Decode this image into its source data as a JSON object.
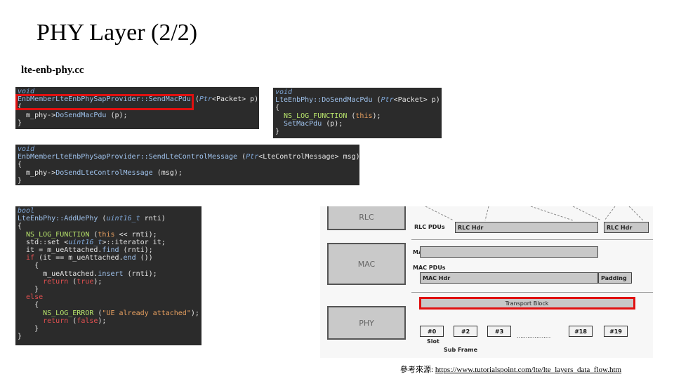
{
  "title": "PHY Layer (2/2)",
  "subtitle": "lte-enb-phy.cc",
  "code_blocks": [
    {
      "lines": [
        [
          {
            "c": "kw",
            "t": "void"
          }
        ],
        [
          {
            "c": "fn",
            "t": "EnbMemberLteEnbPhySapProvider::SendMacPdu"
          },
          {
            "c": "tx",
            "t": " ("
          },
          {
            "c": "kw",
            "t": "Ptr"
          },
          {
            "c": "tx",
            "t": "<Packet> p)"
          }
        ],
        [
          {
            "c": "tx",
            "t": "{"
          }
        ],
        [
          {
            "c": "tx",
            "t": "  m_phy->"
          },
          {
            "c": "fn",
            "t": "DoSendMacPdu"
          },
          {
            "c": "tx",
            "t": " (p);"
          }
        ],
        [
          {
            "c": "tx",
            "t": "}"
          }
        ]
      ]
    },
    {
      "lines": [
        [
          {
            "c": "kw",
            "t": "void"
          }
        ],
        [
          {
            "c": "fn",
            "t": "LteEnbPhy::DoSendMacPdu"
          },
          {
            "c": "tx",
            "t": " ("
          },
          {
            "c": "kw",
            "t": "Ptr"
          },
          {
            "c": "tx",
            "t": "<Packet> p)"
          }
        ],
        [
          {
            "c": "tx",
            "t": "{"
          }
        ],
        [
          {
            "c": "mac",
            "t": "  NS_LOG_FUNCTION"
          },
          {
            "c": "tx",
            "t": " ("
          },
          {
            "c": "str",
            "t": "this"
          },
          {
            "c": "tx",
            "t": ");"
          }
        ],
        [
          {
            "c": "fn",
            "t": "  SetMacPdu"
          },
          {
            "c": "tx",
            "t": " (p);"
          }
        ],
        [
          {
            "c": "tx",
            "t": "}"
          }
        ]
      ]
    },
    {
      "lines": [
        [
          {
            "c": "kw",
            "t": "void"
          }
        ],
        [
          {
            "c": "fn",
            "t": "EnbMemberLteEnbPhySapProvider::SendLteControlMessage"
          },
          {
            "c": "tx",
            "t": " ("
          },
          {
            "c": "kw",
            "t": "Ptr"
          },
          {
            "c": "tx",
            "t": "<LteControlMessage> msg)"
          }
        ],
        [
          {
            "c": "tx",
            "t": "{"
          }
        ],
        [
          {
            "c": "tx",
            "t": "  m_phy->"
          },
          {
            "c": "fn",
            "t": "DoSendLteControlMessage"
          },
          {
            "c": "tx",
            "t": " (msg);"
          }
        ],
        [
          {
            "c": "tx",
            "t": "}"
          }
        ]
      ]
    },
    {
      "lines": [
        [
          {
            "c": "kw",
            "t": "bool"
          }
        ],
        [
          {
            "c": "fn",
            "t": "LteEnbPhy::AddUePhy"
          },
          {
            "c": "tx",
            "t": " ("
          },
          {
            "c": "kw",
            "t": "uint16_t"
          },
          {
            "c": "tx",
            "t": " rnti)"
          }
        ],
        [
          {
            "c": "tx",
            "t": "{"
          }
        ],
        [
          {
            "c": "mac",
            "t": "  NS_LOG_FUNCTION"
          },
          {
            "c": "tx",
            "t": " ("
          },
          {
            "c": "str",
            "t": "this"
          },
          {
            "c": "tx",
            "t": " << rnti);"
          }
        ],
        [
          {
            "c": "tx",
            "t": "  std::set <"
          },
          {
            "c": "kw",
            "t": "uint16_t"
          },
          {
            "c": "tx",
            "t": ">::iterator it;"
          }
        ],
        [
          {
            "c": "tx",
            "t": "  it = m_ueAttached."
          },
          {
            "c": "fn",
            "t": "find"
          },
          {
            "c": "tx",
            "t": " (rnti);"
          }
        ],
        [
          {
            "c": "red-kw",
            "t": "  if"
          },
          {
            "c": "tx",
            "t": " (it == m_ueAttached."
          },
          {
            "c": "fn",
            "t": "end"
          },
          {
            "c": "tx",
            "t": " ())"
          }
        ],
        [
          {
            "c": "tx",
            "t": "    {"
          }
        ],
        [
          {
            "c": "tx",
            "t": "      m_ueAttached."
          },
          {
            "c": "fn",
            "t": "insert"
          },
          {
            "c": "tx",
            "t": " (rnti);"
          }
        ],
        [
          {
            "c": "red-kw",
            "t": "      return"
          },
          {
            "c": "tx",
            "t": " ("
          },
          {
            "c": "red-kw",
            "t": "true"
          },
          {
            "c": "tx",
            "t": ");"
          }
        ],
        [
          {
            "c": "tx",
            "t": "    }"
          }
        ],
        [
          {
            "c": "red-kw",
            "t": "  else"
          }
        ],
        [
          {
            "c": "tx",
            "t": "    {"
          }
        ],
        [
          {
            "c": "mac",
            "t": "      NS_LOG_ERROR"
          },
          {
            "c": "tx",
            "t": " ("
          },
          {
            "c": "str",
            "t": "\"UE already attached\""
          },
          {
            "c": "tx",
            "t": ");"
          }
        ],
        [
          {
            "c": "red-kw",
            "t": "      return"
          },
          {
            "c": "tx",
            "t": " ("
          },
          {
            "c": "red-kw",
            "t": "false"
          },
          {
            "c": "tx",
            "t": ");"
          }
        ],
        [
          {
            "c": "tx",
            "t": "    }"
          }
        ],
        [
          {
            "c": "tx",
            "t": "}"
          }
        ]
      ]
    }
  ],
  "diagram": {
    "layers": [
      "RLC",
      "MAC",
      "PHY"
    ],
    "row_labels": {
      "rlc_pdus": "RLC PDUs",
      "mac_sdus": "MAC SDUs",
      "mac_pdus": "MAC PDUs",
      "slot": "Slot",
      "subframe": "Sub Frame"
    },
    "bars": {
      "rlc_hdr_1": "RLC Hdr",
      "rlc_hdr_2": "RLC Hdr",
      "mac_hdr": "MAC Hdr",
      "padding": "Padding",
      "transport_block": "Transport Block"
    },
    "slots": [
      "#0",
      "#2",
      "#3",
      "#18",
      "#19"
    ],
    "ellipsis": "..................."
  },
  "footer": {
    "prefix": "參考來源: ",
    "url": "https://www.tutorialspoint.com/lte/lte_layers_data_flow.htm"
  },
  "colors": {
    "highlight": "#e01010",
    "code_bg": "#2b2b2b"
  }
}
